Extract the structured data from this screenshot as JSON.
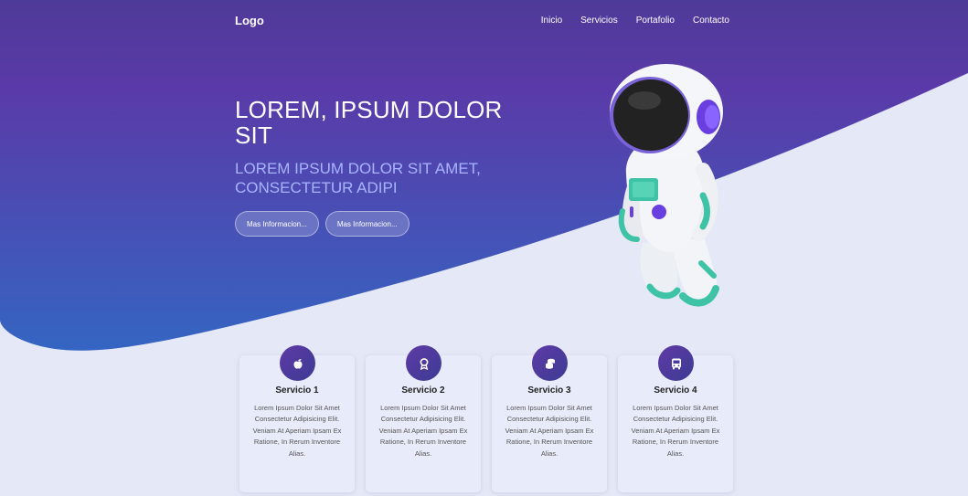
{
  "header": {
    "logo": "Logo",
    "nav": [
      "Inicio",
      "Servicios",
      "Portafolio",
      "Contacto"
    ]
  },
  "hero": {
    "title": "LOREM, IPSUM DOLOR SIT",
    "subtitle": "LOREM IPSUM DOLOR SIT AMET, CONSECTETUR ADIPI",
    "buttons": [
      "Mas Informacion...",
      "Mas Informacion..."
    ]
  },
  "services": [
    {
      "title": "Servicio 1",
      "icon": "apple-icon",
      "text": "Lorem Ipsum Dolor Sit Amet Consectetur Adipisicing Elit. Veniam At Aperiam Ipsam Ex Ratione, In Rerum Inventore Alias."
    },
    {
      "title": "Servicio 2",
      "icon": "award-icon",
      "text": "Lorem Ipsum Dolor Sit Amet Consectetur Adipisicing Elit. Veniam At Aperiam Ipsam Ex Ratione, In Rerum Inventore Alias."
    },
    {
      "title": "Servicio 3",
      "icon": "coins-icon",
      "text": "Lorem Ipsum Dolor Sit Amet Consectetur Adipisicing Elit. Veniam At Aperiam Ipsam Ex Ratione, In Rerum Inventore Alias."
    },
    {
      "title": "Servicio 4",
      "icon": "bus-icon",
      "text": "Lorem Ipsum Dolor Sit Amet Consectetur Adipisicing Elit. Veniam At Aperiam Ipsam Ex Ratione, In Rerum Inventore Alias."
    }
  ],
  "colors": {
    "hero_top": "#523a9a",
    "hero_bottom": "#3a63c0",
    "page_bg": "#e5e9f7",
    "accent": "#5e3aa5",
    "subtitle": "#a9b4ff"
  }
}
